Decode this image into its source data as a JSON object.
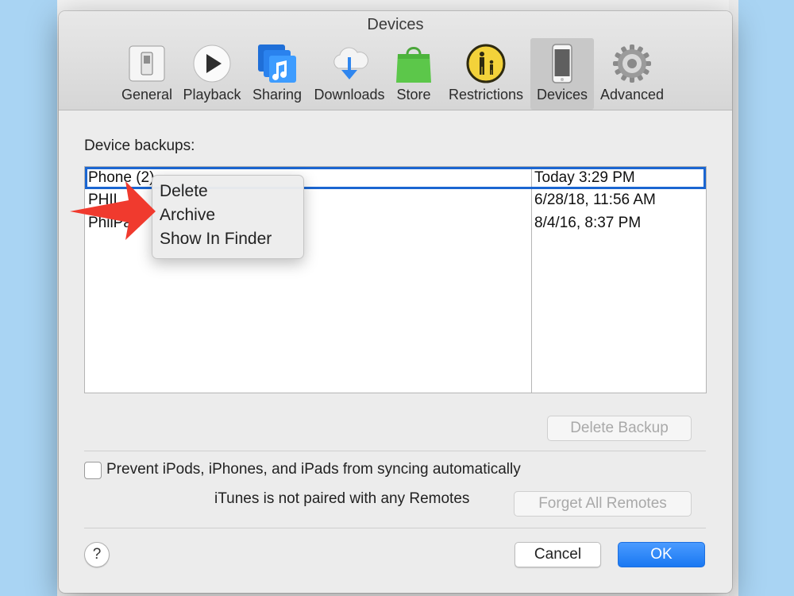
{
  "window": {
    "title": "Devices"
  },
  "tabs": [
    {
      "label": "General",
      "icon": "general-switch-icon"
    },
    {
      "label": "Playback",
      "icon": "play-icon"
    },
    {
      "label": "Sharing",
      "icon": "sharing-music-icon"
    },
    {
      "label": "Downloads",
      "icon": "download-cloud-icon"
    },
    {
      "label": "Store",
      "icon": "shopping-bag-icon"
    },
    {
      "label": "Restrictions",
      "icon": "parental-restrictions-icon"
    },
    {
      "label": "Devices",
      "icon": "iphone-icon",
      "active": true
    },
    {
      "label": "Advanced",
      "icon": "gear-icon"
    }
  ],
  "backups": {
    "label": "Device backups:",
    "rows": [
      {
        "name": "Phone (2)",
        "date": "Today 3:29 PM",
        "selected": true
      },
      {
        "name": "PHIL",
        "date": "6/28/18, 11:56 AM"
      },
      {
        "name": "PhilPad",
        "date": "8/4/16, 8:37 PM"
      }
    ],
    "delete_button": "Delete Backup"
  },
  "context_menu": {
    "items": [
      "Delete",
      "Archive",
      "Show In Finder"
    ]
  },
  "options": {
    "prevent_sync_label": "Prevent iPods, iPhones, and iPads from syncing automatically",
    "prevent_sync_checked": false,
    "remotes_text": "iTunes is not paired with any Remotes",
    "forget_button": "Forget All Remotes"
  },
  "footer": {
    "help": "?",
    "cancel": "Cancel",
    "ok": "OK"
  },
  "colors": {
    "accent": "#1b66d1",
    "primary_button": "#1a78f2",
    "annotation_arrow": "#f03a2e",
    "background": "#a9d4f3"
  }
}
